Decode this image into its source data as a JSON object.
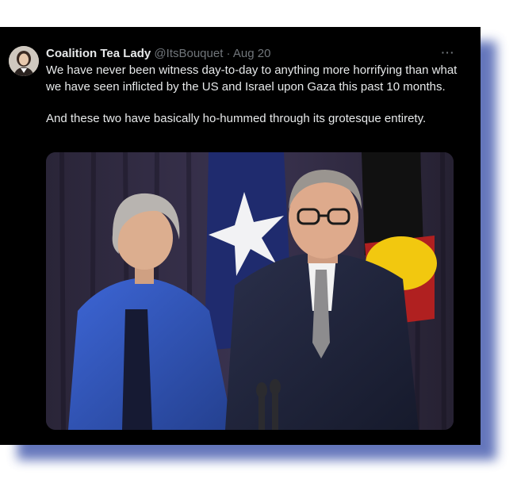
{
  "tweet": {
    "author_name": "Coalition Tea Lady",
    "handle": "@ItsBouquet",
    "separator": "·",
    "date": "Aug 20",
    "more_label": "···",
    "paragraphs": [
      "We have never been witness day-to-day to anything more horrifying than what we have seen inflicted by the US and Israel upon Gaza this past 10 months.",
      "And these two have basically ho-hummed through its grotesque entirety."
    ]
  },
  "colors": {
    "card_background": "#000000",
    "text_primary": "#e7e9ea",
    "text_secondary": "#71767b",
    "shadow_accent": "#4a5fb0"
  }
}
